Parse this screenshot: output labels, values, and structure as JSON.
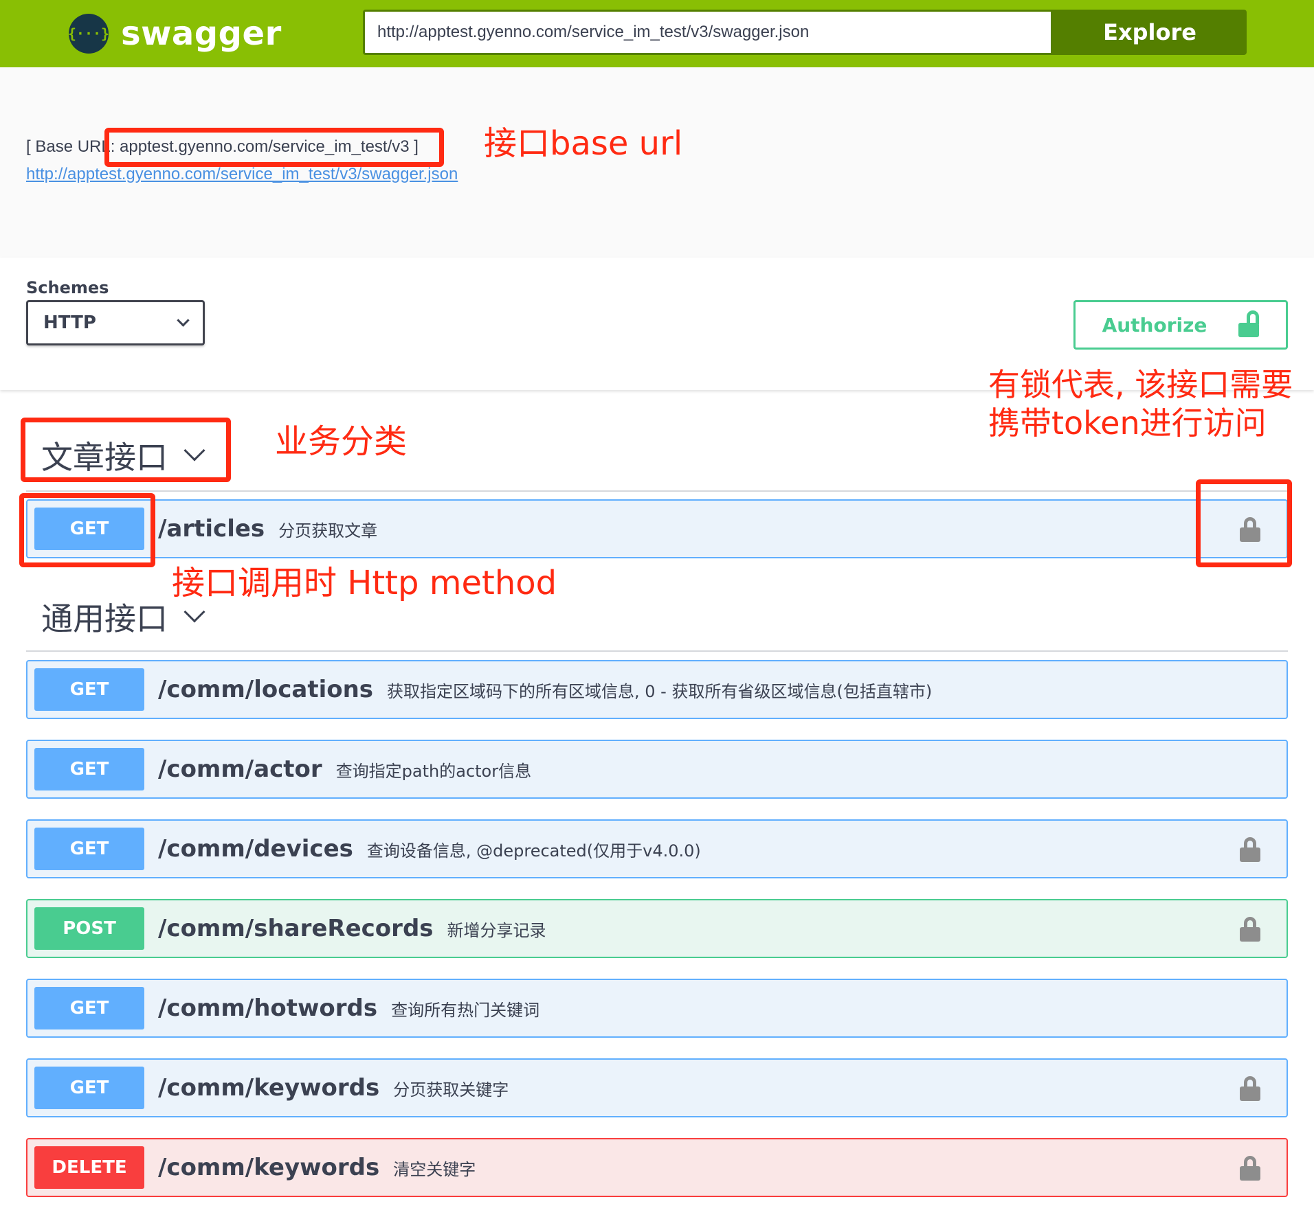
{
  "topbar": {
    "logo_glyph": "{···}",
    "logo_text": "swagger",
    "url_value": "http://apptest.gyenno.com/service_im_test/v3/swagger.json",
    "explore_label": "Explore",
    "bar_color": "#89bf04",
    "button_color": "#547f00"
  },
  "info": {
    "base_url_text": "[ Base URL: apptest.gyenno.com/service_im_test/v3 ]",
    "spec_link": "http://apptest.gyenno.com/service_im_test/v3/swagger.json"
  },
  "scheme": {
    "label": "Schemes",
    "selected": "HTTP",
    "authorize_label": "Authorize"
  },
  "tags": [
    {
      "name": "文章接口",
      "operations": [
        {
          "method": "GET",
          "path": "/articles",
          "summary": "分页获取文章",
          "locked": true
        }
      ]
    },
    {
      "name": "通用接口",
      "operations": [
        {
          "method": "GET",
          "path": "/comm/locations",
          "summary": "获取指定区域码下的所有区域信息, 0 - 获取所有省级区域信息(包括直辖市)",
          "locked": false
        },
        {
          "method": "GET",
          "path": "/comm/actor",
          "summary": "查询指定path的actor信息",
          "locked": false
        },
        {
          "method": "GET",
          "path": "/comm/devices",
          "summary": "查询设备信息, @deprecated(仅用于v4.0.0)",
          "locked": true
        },
        {
          "method": "POST",
          "path": "/comm/shareRecords",
          "summary": "新增分享记录",
          "locked": true
        },
        {
          "method": "GET",
          "path": "/comm/hotwords",
          "summary": "查询所有热门关键词",
          "locked": false
        },
        {
          "method": "GET",
          "path": "/comm/keywords",
          "summary": "分页获取关键字",
          "locked": true
        },
        {
          "method": "DELETE",
          "path": "/comm/keywords",
          "summary": "清空关键字",
          "locked": true
        }
      ]
    }
  ],
  "method_colors": {
    "GET": "#61affe",
    "POST": "#49cc90",
    "DELETE": "#f93e3e"
  },
  "annotations": {
    "base_url_note": "接口base url",
    "category_note": "业务分类",
    "method_note": "接口调用时 Http method",
    "lock_note_line1": "有锁代表, 该接口需要",
    "lock_note_line2": "携带token进行访问",
    "color": "#ff2a12"
  }
}
